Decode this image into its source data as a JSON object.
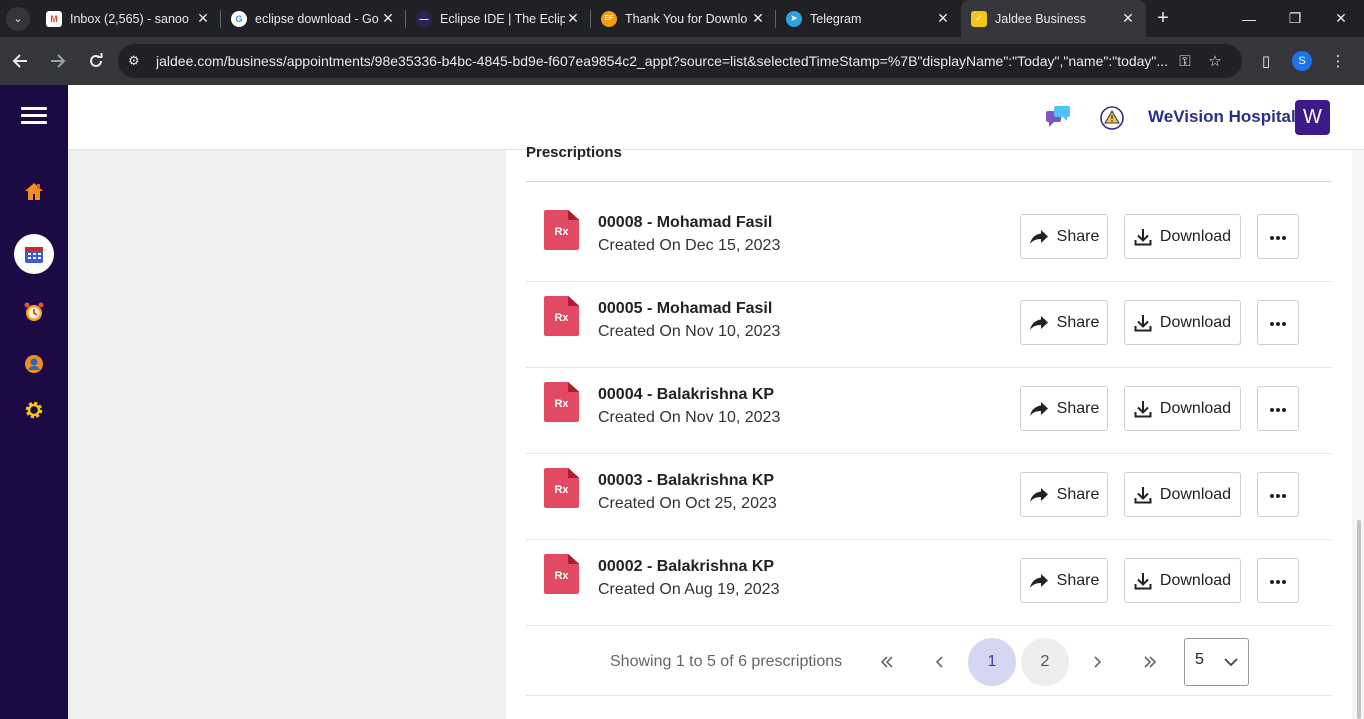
{
  "browser": {
    "tabs": [
      {
        "title": "Inbox (2,565) - sanoo",
        "favicon": "gmail-icon",
        "active": false
      },
      {
        "title": "eclipse download - Go",
        "favicon": "google-icon",
        "active": false
      },
      {
        "title": "Eclipse IDE | The Eclip",
        "favicon": "eclipse-icon",
        "active": false
      },
      {
        "title": "Thank You for Downlo",
        "favicon": "ef-icon",
        "active": false
      },
      {
        "title": "Telegram",
        "favicon": "telegram-icon",
        "active": false
      },
      {
        "title": "Jaldee Business",
        "favicon": "jaldee-icon",
        "active": true
      }
    ],
    "url": "jaldee.com/business/appointments/98e35336-b4bc-4845-bd9e-f607ea9854c2_appt?source=list&selectedTimeStamp=%7B\"displayName\":\"Today\",\"name\":\"today\"...",
    "profile_initial": "S"
  },
  "app": {
    "hospital_name": "WeVision Hospital",
    "avatar_initial": "W",
    "section_title": "Prescriptions",
    "rx_label": "Rx",
    "share_label": "Share",
    "download_label": "Download",
    "prescriptions": [
      {
        "title": "00008 - Mohamad Fasil",
        "created": "Created On Dec 15, 2023"
      },
      {
        "title": "00005 - Mohamad Fasil",
        "created": "Created On Nov 10, 2023"
      },
      {
        "title": "00004 - Balakrishna KP",
        "created": "Created On Nov 10, 2023"
      },
      {
        "title": "00003 - Balakrishna KP",
        "created": "Created On Oct 25, 2023"
      },
      {
        "title": "00002 - Balakrishna KP",
        "created": "Created On Aug 19, 2023"
      }
    ],
    "pagination": {
      "info": "Showing 1 to 5 of 6 prescriptions",
      "pages": [
        "1",
        "2"
      ],
      "current": "1",
      "page_size": "5",
      "first": "«",
      "prev": "‹",
      "next": "›",
      "last": "»"
    }
  },
  "colors": {
    "nav_bg": "#1c0a45",
    "rx_red": "#e14a62",
    "active_page": "#d5d7f2"
  }
}
